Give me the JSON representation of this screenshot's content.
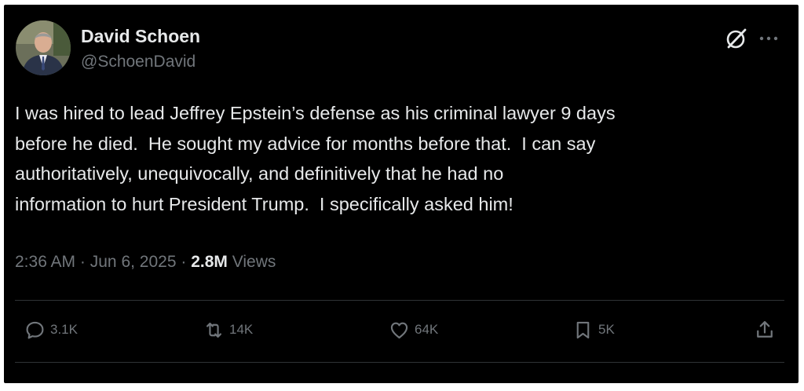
{
  "author": {
    "name": "David Schoen",
    "handle": "@SchoenDavid"
  },
  "post": {
    "text": "I was hired to lead Jeffrey Epstein’s defense as his criminal lawyer 9 days\nbefore he died.  He sought my advice for months before that.  I can say\nauthoritatively, unequivocally, and definitively that he had no\ninformation to hurt President Trump.  I specifically asked him!",
    "time": "2:36 AM",
    "separator": "·",
    "date": "Jun 6, 2025",
    "views_count": "2.8M",
    "views_label": "Views"
  },
  "actions": {
    "replies": "3.1K",
    "reposts": "14K",
    "likes": "64K",
    "bookmarks": "5K"
  },
  "icons": {
    "grok": "grok-icon",
    "more": "more-icon",
    "reply": "reply-icon",
    "repost": "repost-icon",
    "like": "heart-icon",
    "bookmark": "bookmark-icon",
    "share": "share-icon"
  },
  "colors": {
    "background": "#000000",
    "text_primary": "#e7e9ea",
    "text_secondary": "#71767b",
    "divider": "#2f3336"
  }
}
